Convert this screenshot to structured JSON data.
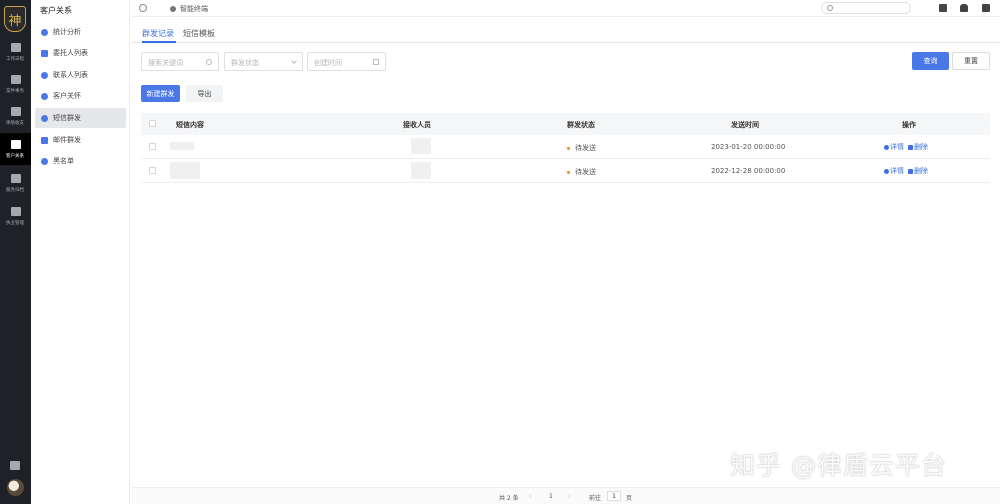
{
  "rail": {
    "logo_char": "神",
    "items": [
      {
        "label": "工作日程",
        "icon": "calendar-icon"
      },
      {
        "label": "案件事务",
        "icon": "document-icon"
      },
      {
        "label": "律助收支",
        "icon": "money-icon"
      },
      {
        "label": "客户关系",
        "icon": "user-icon"
      },
      {
        "label": "服务归档",
        "icon": "archive-icon"
      },
      {
        "label": "执业管理",
        "icon": "edit-icon"
      }
    ],
    "active_index": 3
  },
  "sidebar": {
    "title": "客户关系",
    "items": [
      {
        "label": "统计分析",
        "icon": "pie-icon"
      },
      {
        "label": "委托人列表",
        "icon": "document-icon"
      },
      {
        "label": "联系人列表",
        "icon": "user-icon"
      },
      {
        "label": "客户关怀",
        "icon": "user-icon"
      },
      {
        "label": "短信群发",
        "icon": "message-icon"
      },
      {
        "label": "邮件群发",
        "icon": "mail-icon"
      },
      {
        "label": "黑名单",
        "icon": "block-icon"
      }
    ],
    "active_index": 4
  },
  "topbar": {
    "breadcrumb": "智能终端"
  },
  "tabs": [
    {
      "label": "群发记录"
    },
    {
      "label": "短信模板"
    }
  ],
  "filters": {
    "keyword_placeholder": "搜索关键词",
    "status_placeholder": "群发状态",
    "time_placeholder": "创建时间",
    "search_label": "查询",
    "reset_label": "重置"
  },
  "actions": {
    "new_label": "新建群发",
    "export_label": "导出"
  },
  "table": {
    "columns": [
      "短信内容",
      "接收人员",
      "群发状态",
      "发送时间",
      "操作"
    ],
    "rows": [
      {
        "status": "待发送",
        "time": "2023-01-20 00:00:00",
        "detail": "详情",
        "delete": "删除"
      },
      {
        "status": "待发送",
        "time": "2022-12-28 00:00:00",
        "detail": "详情",
        "delete": "删除"
      }
    ]
  },
  "pagination": {
    "total": "共 2 条",
    "page": "1",
    "goto_label": "前往",
    "goto_value": "1",
    "page_suffix": "页"
  },
  "watermark": "知乎 @律盾云平台",
  "colors": {
    "accent": "#4a78e8",
    "rail_bg": "#1f2129",
    "status_pending": "#f08c1a"
  }
}
